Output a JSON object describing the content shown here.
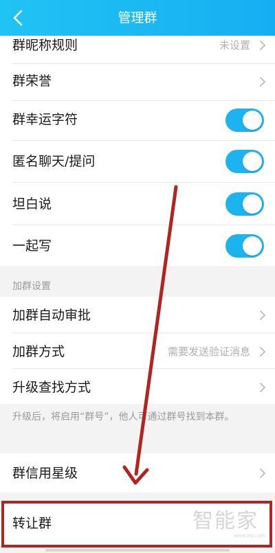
{
  "header": {
    "title": "管理群",
    "back_icon": "chevron-left-icon"
  },
  "settings": [
    {
      "label": "群昵称规则",
      "value": "未设置",
      "control": "chevron"
    },
    {
      "label": "群荣誉",
      "value": "",
      "control": "chevron"
    },
    {
      "label": "群幸运字符",
      "control": "toggle",
      "on": true
    },
    {
      "label": "匿名聊天/提问",
      "control": "toggle",
      "on": true
    },
    {
      "label": "坦白说",
      "control": "toggle",
      "on": true
    },
    {
      "label": "一起写",
      "control": "toggle",
      "on": true
    }
  ],
  "join_section": {
    "header": "加群设置",
    "items": [
      {
        "label": "加群自动审批",
        "value": "",
        "control": "chevron"
      },
      {
        "label": "加群方式",
        "value": "需要发送验证消息",
        "control": "chevron"
      },
      {
        "label": "升级查找方式",
        "value": "",
        "control": "chevron"
      }
    ],
    "footnote": "升级后，将启用“群号”，他人可通过群号找到本群。"
  },
  "credit": {
    "label": "群信用星级",
    "control": "chevron"
  },
  "transfer": {
    "label": "转让群"
  },
  "watermark": {
    "text": "智能家",
    "sub": "www.znj.com"
  },
  "colors": {
    "header": "#16aef2",
    "toggle_on": "#1db3ef",
    "annotation": "#b02421"
  }
}
